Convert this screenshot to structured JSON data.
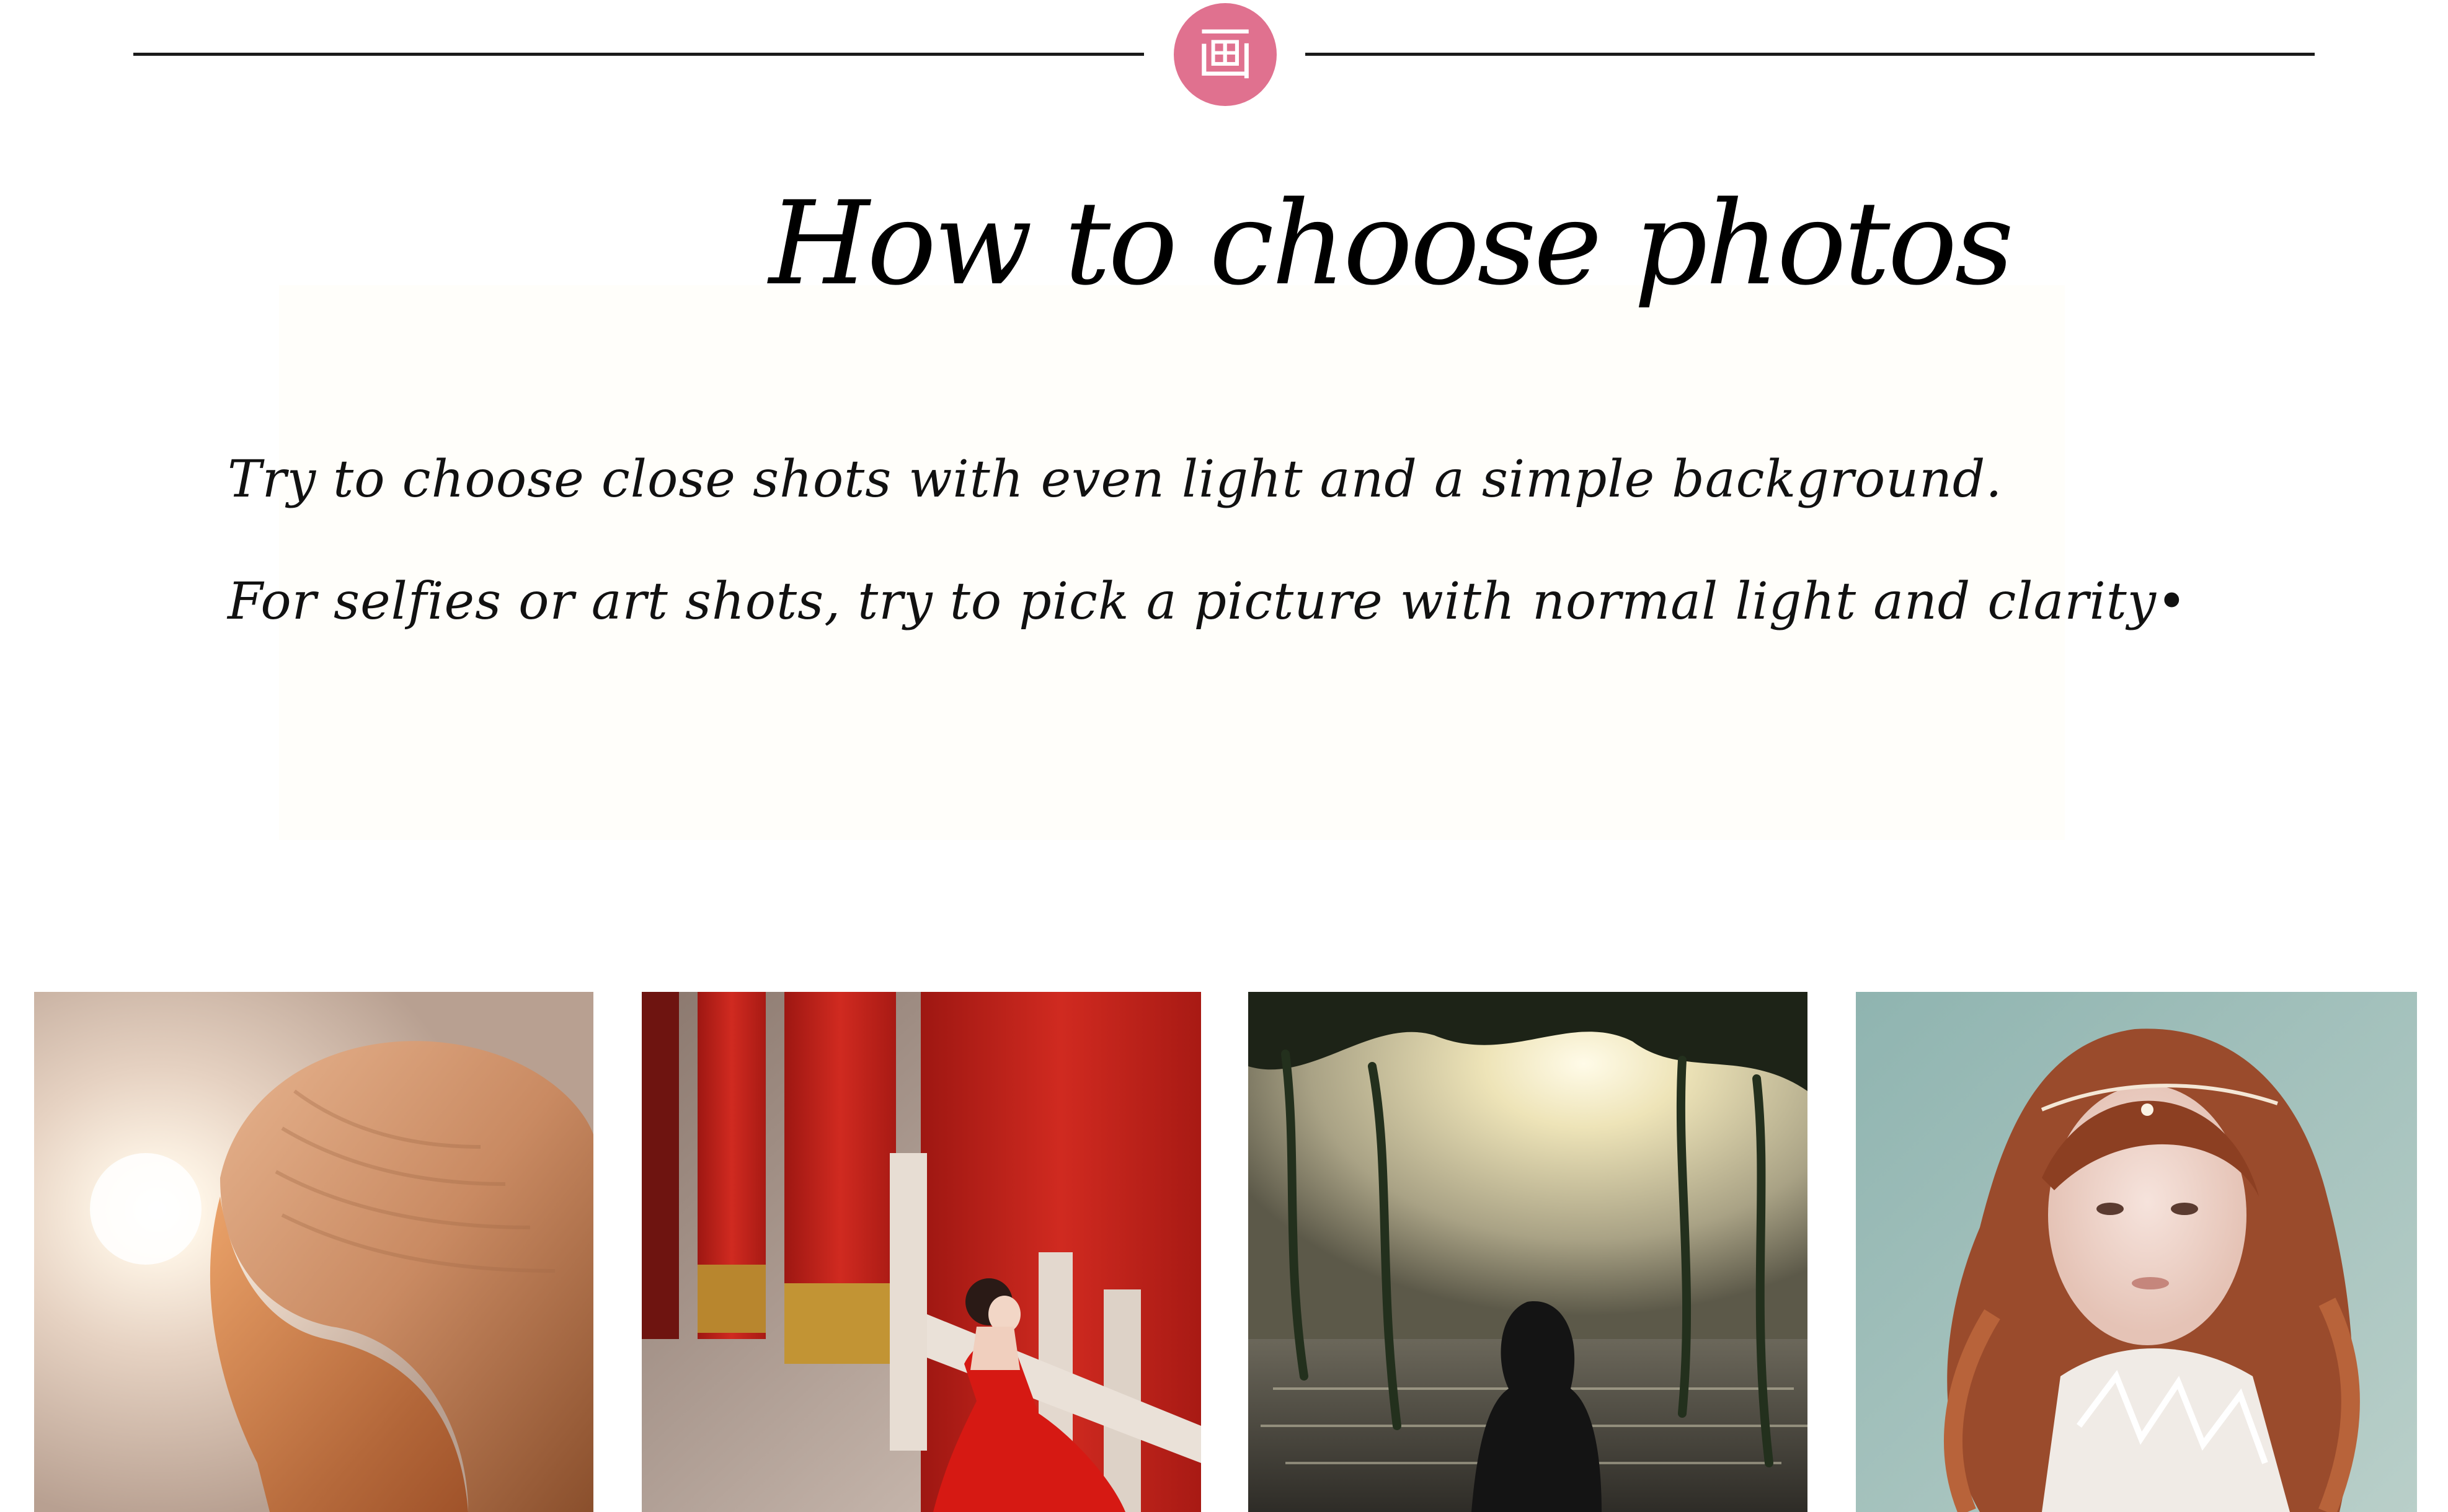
{
  "header": {
    "badge_char": "画",
    "badge_color": "#e0718f"
  },
  "title": "How to choose photos",
  "tips": [
    "Try to choose close shots with even light and a simple background.",
    "For selfies or art shots, try to pick a picture with normal light and clarity•"
  ],
  "photos": [
    {
      "subject": "backlit knit hat against sun"
    },
    {
      "subject": "woman in red gown by red pillars and stone railings"
    },
    {
      "subject": "silhouette of woman facing sea at sunset under trees"
    },
    {
      "subject": "portrait of woman with long curly auburn hair"
    }
  ]
}
